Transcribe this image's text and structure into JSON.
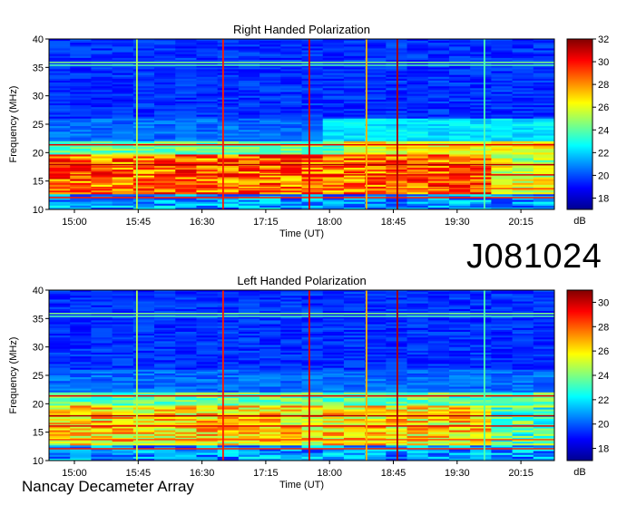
{
  "observation_id": "J081024",
  "credit": "Nancay Decameter Array",
  "chart_data": [
    {
      "type": "heatmap",
      "title": "Right Handed Polarization",
      "xlabel": "Time (UT)",
      "ylabel": "Frequency (MHz)",
      "x_ticks": [
        "15:00",
        "15:45",
        "16:30",
        "17:15",
        "18:00",
        "18:45",
        "19:30",
        "20:15"
      ],
      "y_ticks": [
        10,
        15,
        20,
        25,
        30,
        35,
        40
      ],
      "ylim": [
        10,
        40
      ],
      "colorbar": {
        "unit": "dB",
        "range": [
          17,
          32
        ],
        "ticks": [
          18,
          20,
          22,
          24,
          26,
          28,
          30,
          32
        ]
      }
    },
    {
      "type": "heatmap",
      "title": "Left Handed Polarization",
      "xlabel": "Time (UT)",
      "ylabel": "Frequency (MHz)",
      "x_ticks": [
        "15:00",
        "15:45",
        "16:30",
        "17:15",
        "18:00",
        "18:45",
        "19:30",
        "20:15"
      ],
      "y_ticks": [
        10,
        15,
        20,
        25,
        30,
        35,
        40
      ],
      "ylim": [
        10,
        40
      ],
      "colorbar": {
        "unit": "dB",
        "range": [
          17,
          31
        ],
        "ticks": [
          18,
          20,
          22,
          24,
          26,
          28,
          30
        ]
      }
    }
  ]
}
